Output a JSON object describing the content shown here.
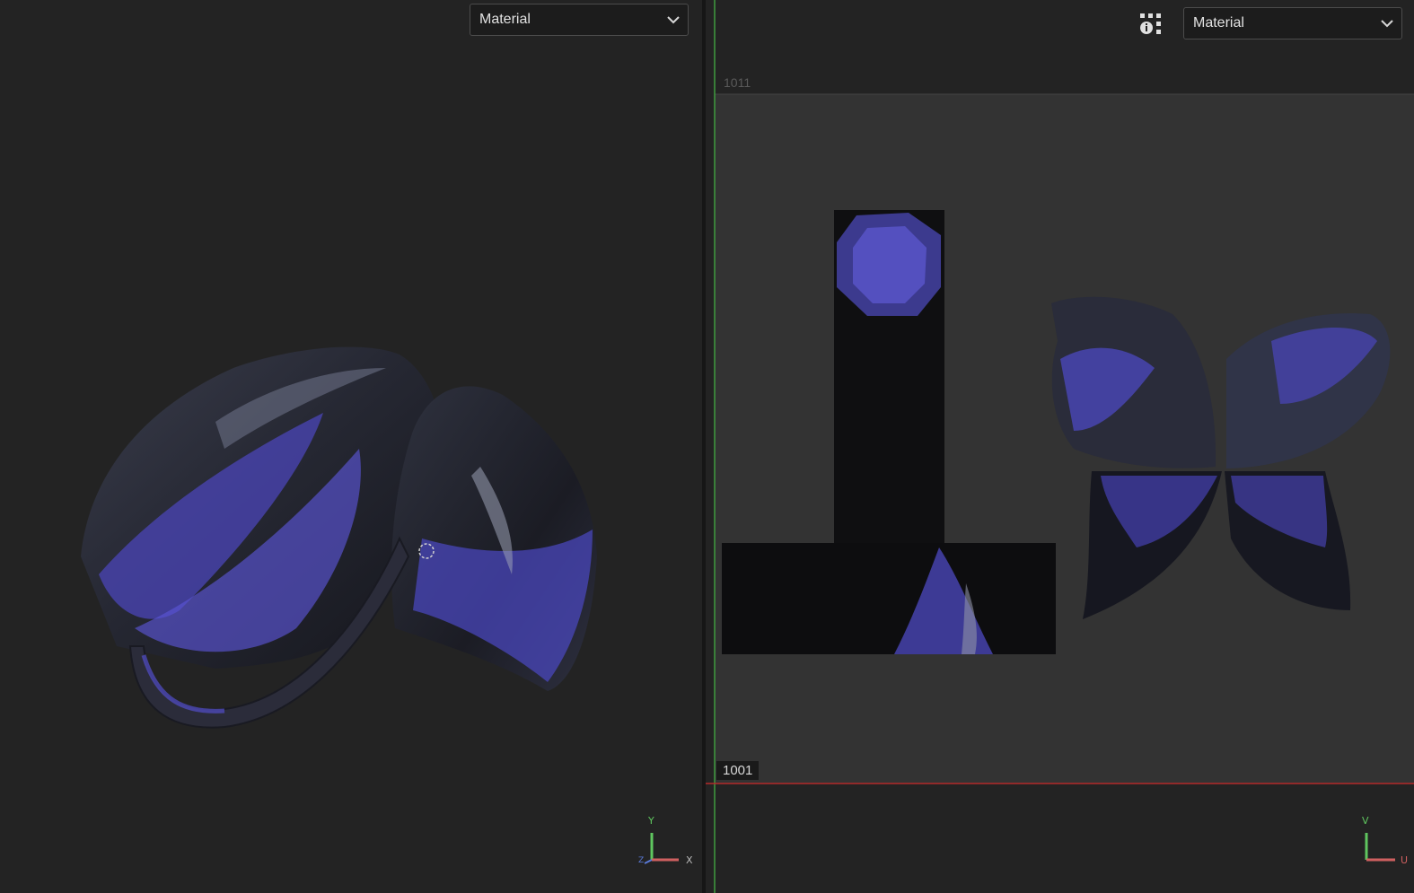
{
  "viewport_3d": {
    "shading_dropdown": {
      "selected": "Material"
    },
    "axes": {
      "y": "Y",
      "x": "X",
      "z": "Z"
    }
  },
  "viewport_uv": {
    "shading_dropdown": {
      "selected": "Material"
    },
    "tile_labels": {
      "top": "1011",
      "bottom": "1001"
    },
    "axes": {
      "v": "V",
      "u": "U"
    }
  },
  "colors": {
    "background": "#232323",
    "uv_tile": "#333333",
    "uv_v_axis": "#3f9d3f",
    "uv_u_axis": "#b32b2b",
    "mesh_blue": "#5650d0",
    "mesh_dark": "#141418"
  },
  "icons": [
    "chevron-down-icon",
    "info-grid-icon",
    "cursor-target-icon",
    "axis-gizmo-icon"
  ]
}
